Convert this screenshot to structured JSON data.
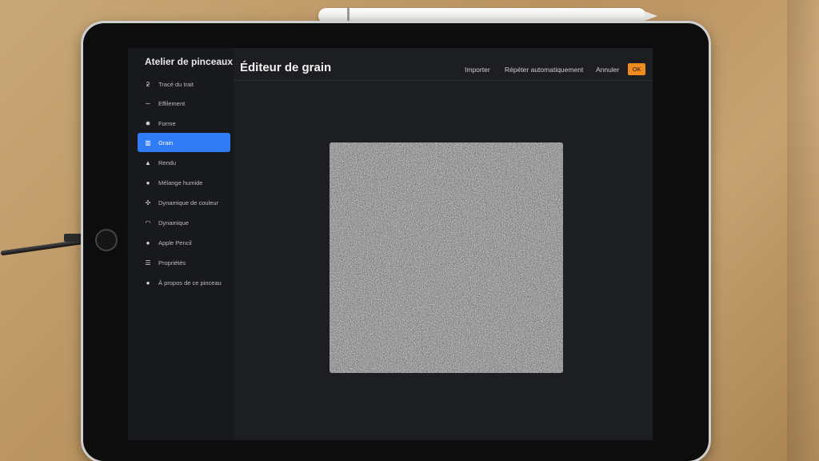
{
  "sidebar": {
    "title": "Atelier de pinceaux",
    "items": [
      {
        "label": "Tracé du trait",
        "icon": "stroke-path-icon",
        "glyph": "ƻ"
      },
      {
        "label": "Effilement",
        "icon": "taper-icon",
        "glyph": "∼"
      },
      {
        "label": "Forme",
        "icon": "shape-icon",
        "glyph": "✹"
      },
      {
        "label": "Grain",
        "icon": "grain-icon",
        "glyph": "▥"
      },
      {
        "label": "Rendu",
        "icon": "render-icon",
        "glyph": "▲"
      },
      {
        "label": "Mélange humide",
        "icon": "wet-mix-icon",
        "glyph": "●"
      },
      {
        "label": "Dynamique de couleur",
        "icon": "color-dynamics-icon",
        "glyph": "✣"
      },
      {
        "label": "Dynamique",
        "icon": "dynamics-icon",
        "glyph": "◠"
      },
      {
        "label": "Apple Pencil",
        "icon": "apple-pencil-icon",
        "glyph": "●"
      },
      {
        "label": "Propriétés",
        "icon": "properties-icon",
        "glyph": "☰"
      },
      {
        "label": "À propos de ce pinceau",
        "icon": "info-icon",
        "glyph": "●"
      }
    ],
    "active_item": "Grain",
    "active_color": "#2f7cf6"
  },
  "header": {
    "title": "Éditeur de grain",
    "import_label": "Importer",
    "auto_repeat_label": "Répéter automatiquement",
    "cancel_label": "Annuler",
    "ok_label": "OK",
    "ok_color": "#f08b1d"
  },
  "canvas": {
    "content": "grain-texture-preview"
  }
}
